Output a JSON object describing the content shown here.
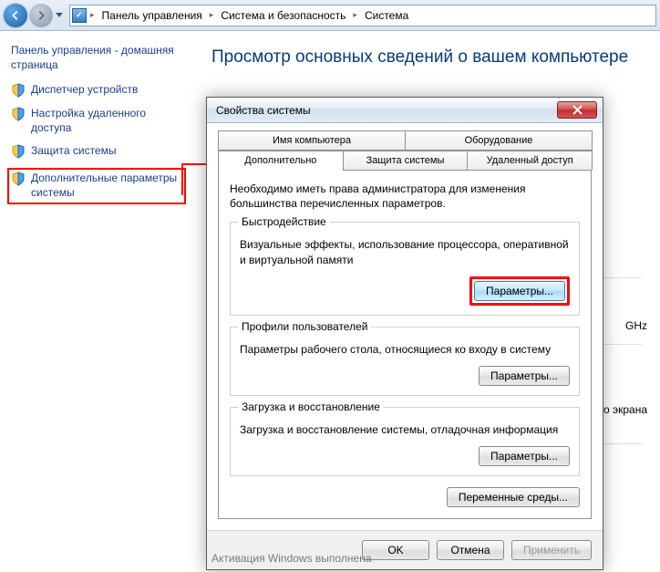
{
  "breadcrumb": {
    "root": "",
    "items": [
      "Панель управления",
      "Система и безопасность",
      "Система"
    ]
  },
  "sidebar": {
    "title": "Панель управления - домашняя страница",
    "items": [
      {
        "label": "Диспетчер устройств"
      },
      {
        "label": "Настройка удаленного доступа"
      },
      {
        "label": "Защита системы"
      },
      {
        "label": "Дополнительные параметры системы"
      }
    ]
  },
  "page": {
    "title": "Просмотр основных сведений о вашем компьютере",
    "bg_ghz": "GHz",
    "bg_screen": "о экрана",
    "activation": "Активация Windows выполнена"
  },
  "dialog": {
    "title": "Свойства системы",
    "tabs": {
      "row1": [
        "Имя компьютера",
        "Оборудование"
      ],
      "row2": [
        "Дополнительно",
        "Защита системы",
        "Удаленный доступ"
      ],
      "active": "Дополнительно"
    },
    "intro": "Необходимо иметь права администратора для изменения большинства перечисленных параметров.",
    "groups": {
      "perf": {
        "legend": "Быстродействие",
        "desc": "Визуальные эффекты, использование процессора, оперативной и виртуальной памяти",
        "button": "Параметры..."
      },
      "profiles": {
        "legend": "Профили пользователей",
        "desc": "Параметры рабочего стола, относящиеся ко входу в систему",
        "button": "Параметры..."
      },
      "boot": {
        "legend": "Загрузка и восстановление",
        "desc": "Загрузка и восстановление системы, отладочная информация",
        "button": "Параметры..."
      }
    },
    "env_button": "Переменные среды...",
    "buttons": {
      "ok": "OK",
      "cancel": "Отмена",
      "apply": "Применить"
    }
  }
}
